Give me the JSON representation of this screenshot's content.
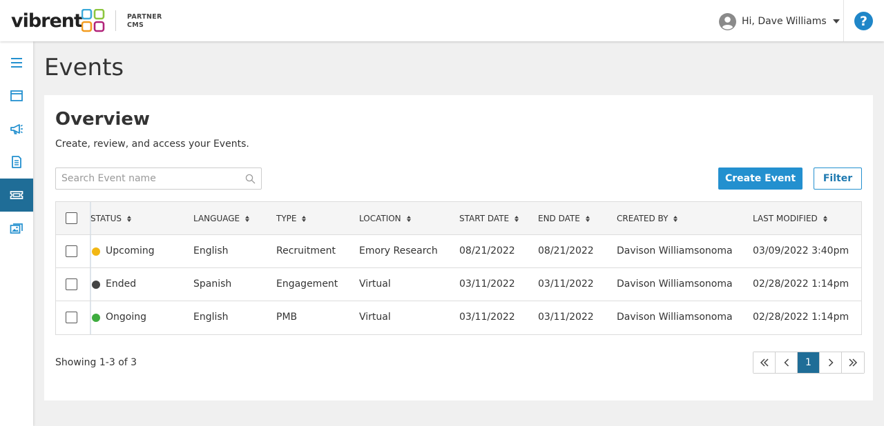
{
  "header": {
    "logo_text": "vibrent",
    "partner_line1": "PARTNER",
    "partner_line2": "CMS",
    "greeting": "Hi, Dave Williams"
  },
  "sidebar": {
    "items": [
      {
        "icon": "menu-icon"
      },
      {
        "icon": "window-icon"
      },
      {
        "icon": "megaphone-icon"
      },
      {
        "icon": "document-icon"
      },
      {
        "icon": "ticket-icon",
        "active": true
      },
      {
        "icon": "images-icon"
      }
    ]
  },
  "page": {
    "title": "Events",
    "overview_title": "Overview",
    "overview_subtitle": "Create, review, and access your Events."
  },
  "search": {
    "placeholder": "Search Event name"
  },
  "actions": {
    "create_label": "Create Event",
    "filter_label": "Filter"
  },
  "table": {
    "columns": [
      "STATUS",
      "LANGUAGE",
      "TYPE",
      "LOCATION",
      "START DATE",
      "END DATE",
      "CREATED BY",
      "LAST MODIFIED"
    ],
    "rows": [
      {
        "status": "Upcoming",
        "status_color": "#f2b714",
        "language": "English",
        "type": "Recruitment",
        "location": "Emory Research",
        "start": "08/21/2022",
        "end": "08/21/2022",
        "created_by": "Davison Williamsonoma",
        "modified": "03/09/2022 3:40pm"
      },
      {
        "status": "Ended",
        "status_color": "#444444",
        "language": "Spanish",
        "type": "Engagement",
        "location": "Virtual",
        "start": "03/11/2022",
        "end": "03/11/2022",
        "created_by": "Davison Williamsonoma",
        "modified": "02/28/2022 1:14pm"
      },
      {
        "status": "Ongoing",
        "status_color": "#3dac3e",
        "language": "English",
        "type": "PMB",
        "location": "Virtual",
        "start": "03/11/2022",
        "end": "03/11/2022",
        "created_by": "Davison Williamsonoma",
        "modified": "02/28/2022 1:14pm"
      }
    ]
  },
  "footer": {
    "showing": "Showing 1-3 of 3",
    "current_page": "1"
  },
  "colors": {
    "primary": "#2390cf",
    "active_nav": "#1f6d97"
  }
}
